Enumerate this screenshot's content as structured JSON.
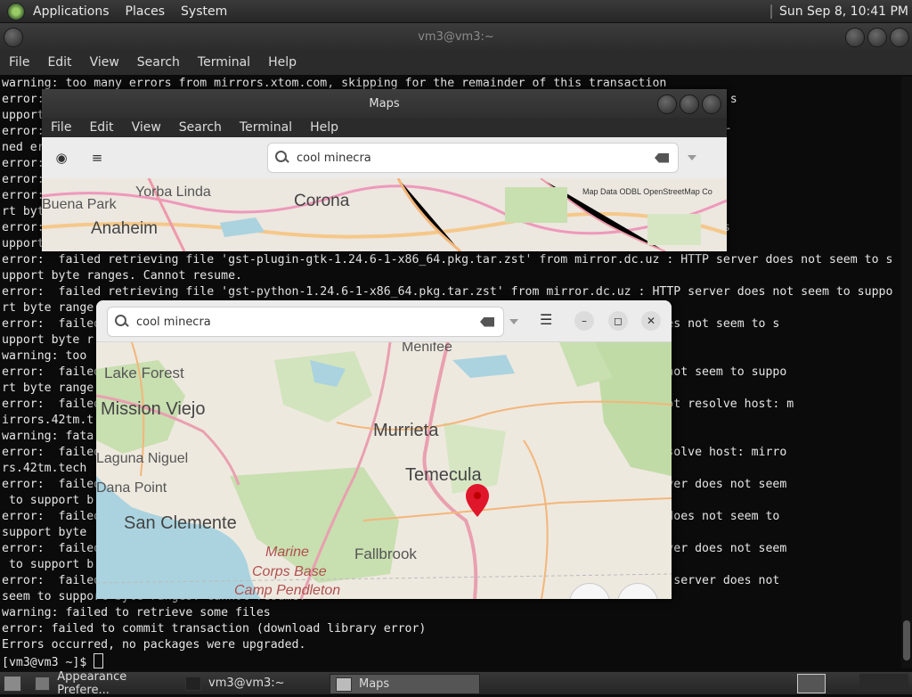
{
  "top_panel": {
    "menus": [
      "Applications",
      "Places",
      "System"
    ],
    "clock": "Sun Sep  8, 10:41 PM"
  },
  "terminal": {
    "title": "vm3@vm3:~",
    "menus": [
      "File",
      "Edit",
      "View",
      "Search",
      "Terminal",
      "Help"
    ],
    "lines": [
      "warning: too many errors from mirrors.xtom.com, skipping for the remainder of this transaction",
      "error:                                                                          erver does not seem to s",
      "upport",
      "error:                                                                          The requested URL retur",
      "ned er",
      "error:                                                                          requested URL returned",
      "error:",
      "error:                                                                          does not seem to suppo",
      "rt byt",
      "error:                                                                          rver does not seem to s",
      "upport",
      "error:  failed retrieving file 'gst-plugin-gtk-1.24.6-1-x86_64.pkg.tar.zst' from mirror.dc.uz : HTTP server does not seem to s",
      "upport byte ranges. Cannot resume.",
      "error:  failed retrieving file 'gst-python-1.24.6-1-x86_64.pkg.tar.zst' from mirror.dc.uz : HTTP server does not seem to suppo",
      "rt byte range",
      "error:  failed                                                                  HTTP server does not seem to s",
      "upport byte r",
      "warning: too",
      "error:  failed                                                                  P server does not seem to suppo",
      "rt byte range",
      "error:  failed                                                                  tech : Could not resolve host: m",
      "irrors.42tm.t",
      "warning: fata",
      "error:  failed                                                                  : Could not resolve host: mirro",
      "rs.42tm.tech",
      "error:  failed                                                                  org : HTTP server does not seem",
      " to support b",
      "error:  failed                                                                  : HTTP server does not seem to",
      "support byte",
      "error:  failed                                                                  .vn : HTTP server does not seem",
      " to support b",
      "error:  failed                                                                  loud.vn : HTTP server does not",
      "seem to support byte ranges. Cannot resume.",
      "warning: failed to retrieve some files",
      "error: failed to commit transaction (download library error)",
      "Errors occurred, no packages were upgraded."
    ],
    "prompt": "[vm3@vm3 ~]$ "
  },
  "maps_back": {
    "title": "Maps",
    "menus": [
      "File",
      "Edit",
      "View",
      "Search",
      "Terminal",
      "Help"
    ],
    "search_value": "cool minecra",
    "attribution": "Map Data ODBL OpenStreetMap Co",
    "map_labels": [
      "Yorba Linda",
      "Buena Park",
      "Corona",
      "Anaheim"
    ]
  },
  "maps_front": {
    "search_value": "cool minecra",
    "map_labels": [
      "Menifee",
      "Lake Forest",
      "Mission Viejo",
      "Murrieta",
      "Laguna Niguel",
      "Temecula",
      "Dana Point",
      "San Clemente",
      "Marine",
      "Corps Base",
      "Camp Pendleton",
      "Fallbrook"
    ]
  },
  "taskbar": {
    "items": [
      "Appearance Prefere...",
      "vm3@vm3:~",
      "Maps"
    ],
    "active_index": 2
  },
  "colors": {
    "terminal_bg": "#0b0b0b",
    "map_land": "#ece7df",
    "map_water": "#aad3df",
    "map_green": "#c8dfb0",
    "pin_red": "#e0162b"
  }
}
